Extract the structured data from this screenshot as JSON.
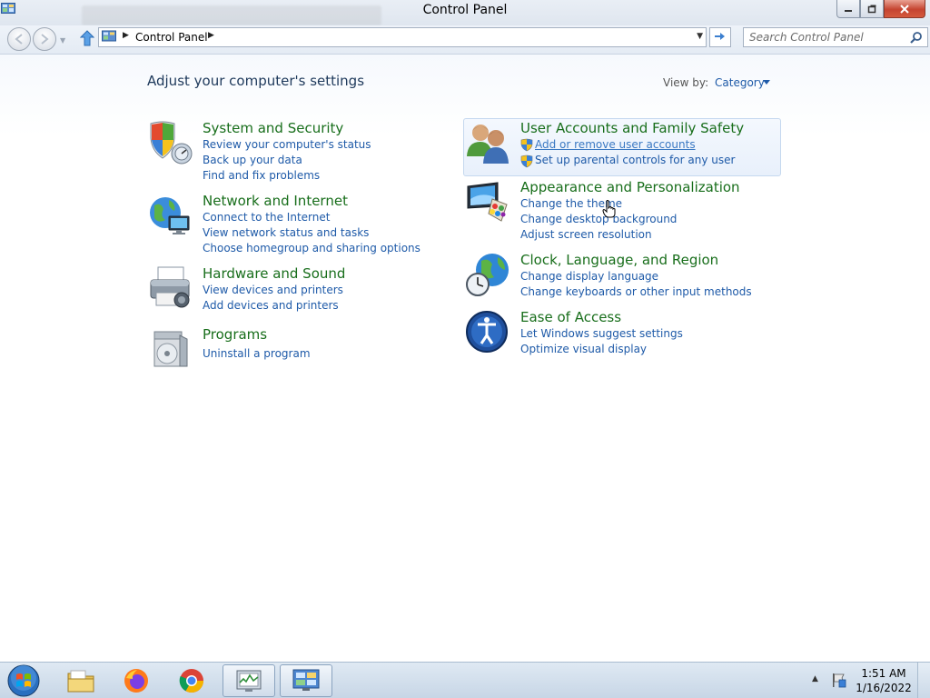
{
  "window": {
    "title": "Control Panel",
    "background_title": "Windows Task Manager"
  },
  "address": {
    "path_label": "Control Panel",
    "search_placeholder": "Search Control Panel"
  },
  "content": {
    "heading": "Adjust your computer's settings",
    "view_by_label": "View by:",
    "view_by_value": "Category"
  },
  "categories": [
    {
      "title": "System and Security",
      "icon": "shield-icon",
      "links": [
        "Review your computer's status",
        "Back up your data",
        "Find and fix problems"
      ]
    },
    {
      "title": "Network and Internet",
      "icon": "network-globe-icon",
      "links": [
        "Connect to the Internet",
        "View network status and tasks",
        "Choose homegroup and sharing options"
      ]
    },
    {
      "title": "Hardware and Sound",
      "icon": "printer-icon",
      "links": [
        "View devices and printers",
        "Add devices and printers"
      ]
    },
    {
      "title": "Programs",
      "icon": "programs-icon",
      "links": [
        "Uninstall a program"
      ]
    },
    {
      "title": "User Accounts and Family Safety",
      "icon": "users-icon",
      "links": [
        "Add or remove user accounts",
        "Set up parental controls for any user"
      ]
    },
    {
      "title": "Appearance and Personalization",
      "icon": "monitor-paint-icon",
      "links": [
        "Change the theme",
        "Change desktop background",
        "Adjust screen resolution"
      ]
    },
    {
      "title": "Clock, Language, and Region",
      "icon": "clock-globe-icon",
      "links": [
        "Change display language",
        "Change keyboards or other input methods"
      ]
    },
    {
      "title": "Ease of Access",
      "icon": "ease-of-access-icon",
      "links": [
        "Let Windows suggest settings",
        "Optimize visual display"
      ]
    }
  ],
  "taskbar": {
    "items": [
      "file-explorer-icon",
      "firefox-icon",
      "chrome-icon",
      "task-manager-icon",
      "control-panel-icon"
    ],
    "clock_time": "1:51 AM",
    "clock_date": "1/16/2022"
  },
  "colors": {
    "category_title": "#186e1b",
    "link": "#1e5aa8",
    "heading": "#1e395b"
  }
}
